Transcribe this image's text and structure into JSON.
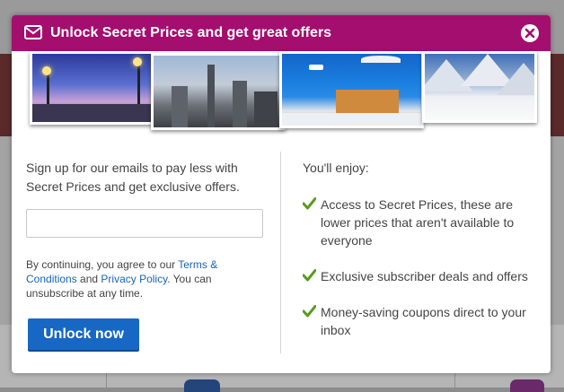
{
  "background": {
    "dim_color": "#8c8c8c"
  },
  "modal": {
    "header": {
      "title": "Unlock Secret Prices and get great offers",
      "color": "#a40e6e"
    },
    "intro": "Sign up for our emails to pay less with Secret Prices and get exclusive offers.",
    "email_input": {
      "value": "",
      "placeholder": ""
    },
    "consent": {
      "prefix": "By continuing, you agree to our ",
      "terms_link": "Terms & Conditions",
      "middle": " and ",
      "privacy_link": "Privacy Policy",
      "suffix": ". You can unsubscribe at any time."
    },
    "unlock_button": "Unlock now",
    "enjoy_title": "You'll enjoy:",
    "benefits": [
      "Access to Secret Prices, these are lower prices that aren't available to everyone",
      "Exclusive subscriber deals and offers",
      "Money-saving coupons direct to your inbox"
    ],
    "accent_check": "#5a9b1f",
    "button_color": "#1668c4"
  }
}
